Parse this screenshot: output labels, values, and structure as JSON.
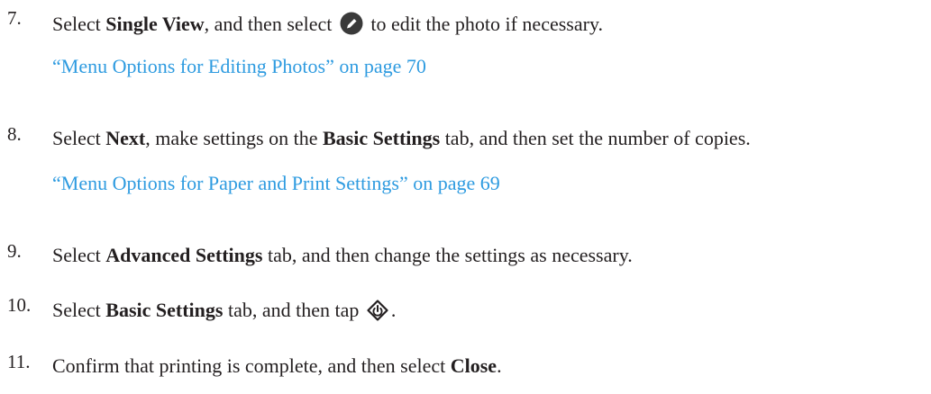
{
  "steps": [
    {
      "number": "7.",
      "parts": {
        "t1": "Select ",
        "b1": "Single View",
        "t2": ", and then select ",
        "icon": "edit-pencil-icon",
        "t3": " to edit the photo if necessary."
      },
      "link": "“Menu Options for Editing Photos” on page 70"
    },
    {
      "number": "8.",
      "parts": {
        "t1": "Select ",
        "b1": "Next",
        "t2": ", make settings on the ",
        "b2": "Basic Settings",
        "t3": " tab, and then set the number of copies."
      },
      "link": "“Menu Options for Paper and Print Settings” on page 69"
    },
    {
      "number": "9.",
      "parts": {
        "t1": "Select ",
        "b1": "Advanced Settings",
        "t2": " tab, and then change the settings as necessary."
      }
    },
    {
      "number": "10.",
      "parts": {
        "t1": "Select ",
        "b1": "Basic Settings",
        "t2": " tab, and then tap ",
        "icon": "start-diamond-icon",
        "t3": "."
      }
    },
    {
      "number": "11.",
      "parts": {
        "t1": "Confirm that printing is complete, and then select ",
        "b1": "Close",
        "t2": "."
      }
    }
  ],
  "colors": {
    "text": "#231f20",
    "link": "#2e9be0"
  }
}
